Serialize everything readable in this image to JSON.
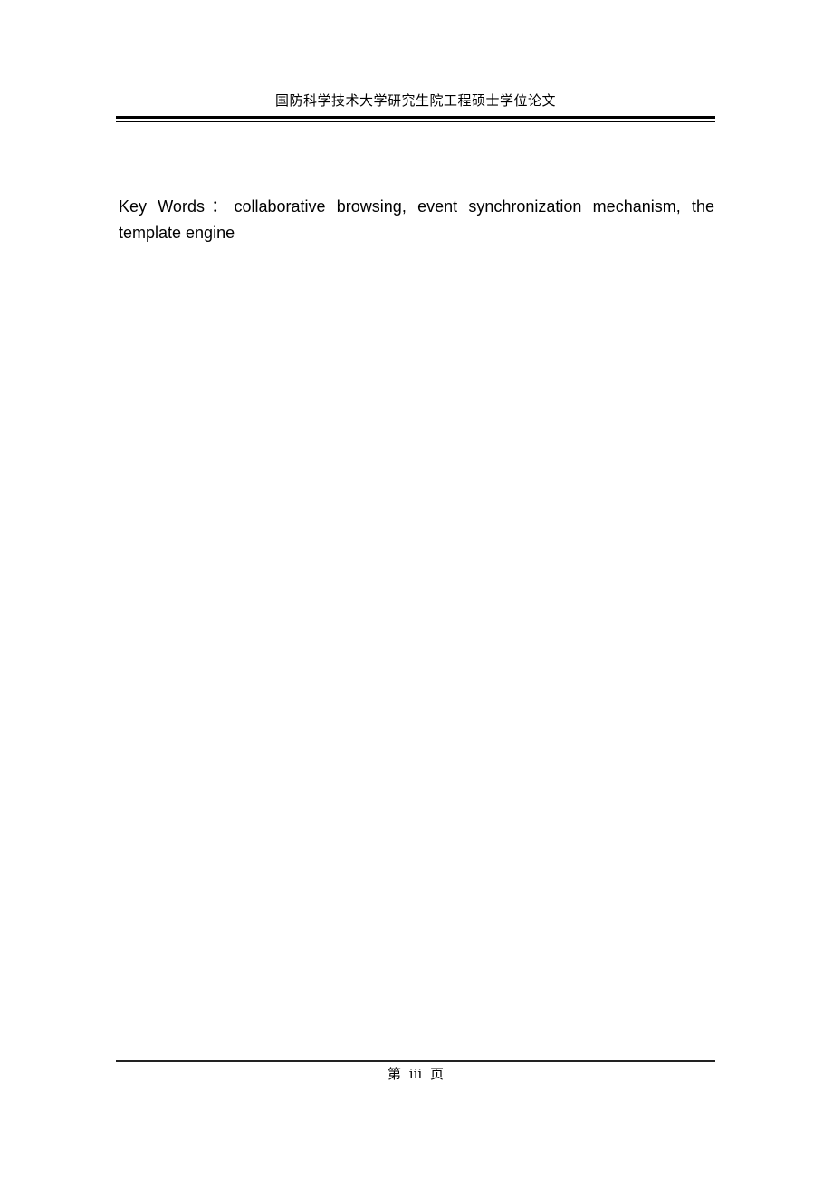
{
  "header": {
    "title": "国防科学技术大学研究生院工程硕士学位论文"
  },
  "body": {
    "keywords_label": "Key Words：",
    "keywords_text": "collaborative browsing, event synchronization mechanism, the template engine"
  },
  "footer": {
    "page_label": "第 iii 页"
  }
}
